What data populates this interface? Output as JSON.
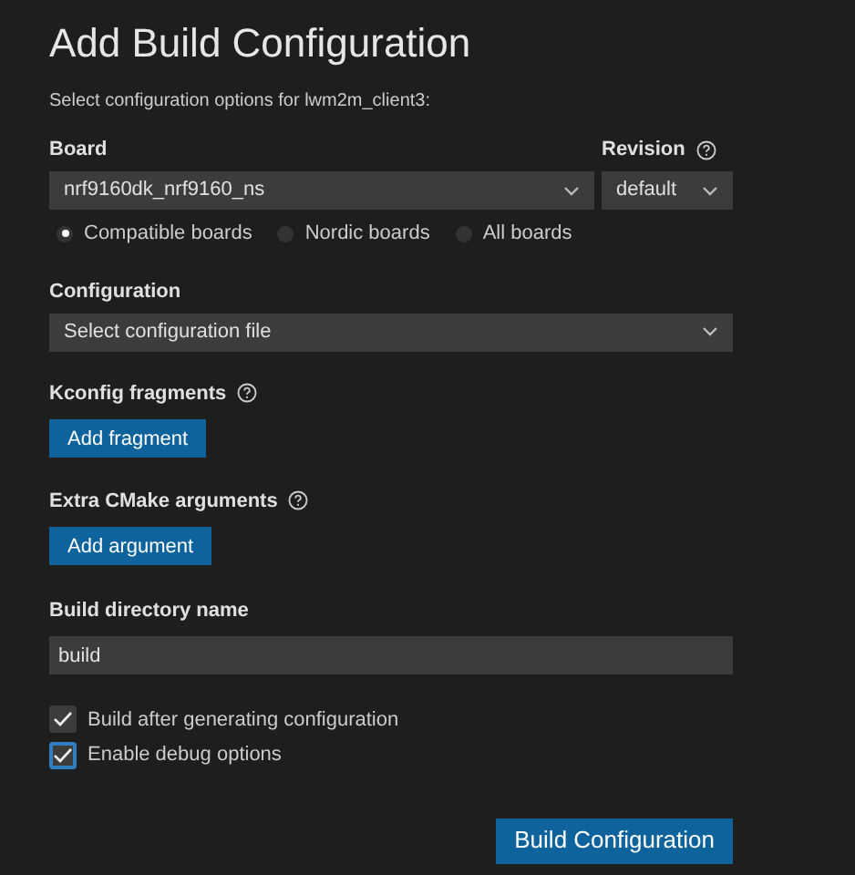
{
  "title": "Add Build Configuration",
  "subtitle": "Select configuration options for lwm2m_client3:",
  "board": {
    "label": "Board",
    "value": "nrf9160dk_nrf9160_ns"
  },
  "revision": {
    "label": "Revision",
    "value": "default"
  },
  "board_filters": [
    {
      "label": "Compatible boards",
      "selected": true
    },
    {
      "label": "Nordic boards",
      "selected": false
    },
    {
      "label": "All boards",
      "selected": false
    }
  ],
  "configuration": {
    "label": "Configuration",
    "value": "Select configuration file"
  },
  "kconfig": {
    "label": "Kconfig fragments",
    "button": "Add fragment"
  },
  "cmake": {
    "label": "Extra CMake arguments",
    "button": "Add argument"
  },
  "build_dir": {
    "label": "Build directory name",
    "value": "build"
  },
  "options": [
    {
      "label": "Build after generating configuration",
      "checked": true,
      "focused": false
    },
    {
      "label": "Enable debug options",
      "checked": true,
      "focused": true
    }
  ],
  "submit": "Build Configuration"
}
